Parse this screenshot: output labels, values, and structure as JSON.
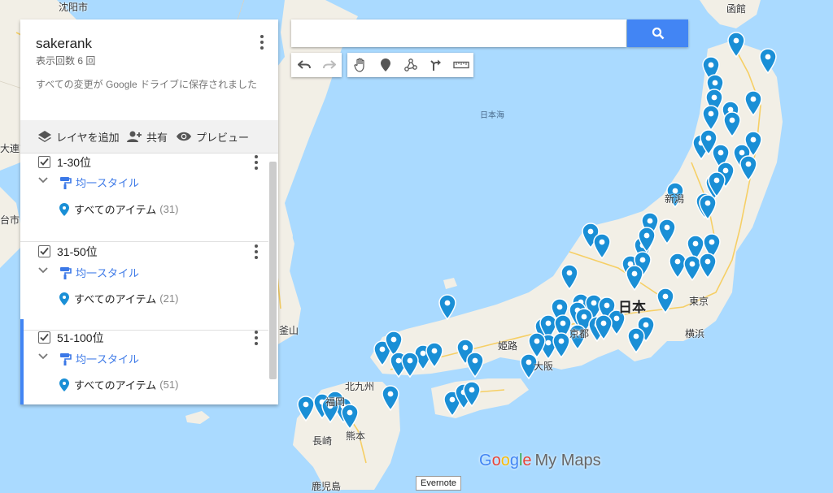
{
  "map": {
    "labels": {
      "shenyang": "沈阳市",
      "hakodate": "函館",
      "dalian": "大連市",
      "qingdao": "台市",
      "busan": "釜山",
      "sea_of_japan": "日本海",
      "japan": "日本",
      "tokyo": "東京",
      "yokohama": "横浜",
      "kyoto": "京都",
      "himeji": "姫路",
      "osaka": "大阪",
      "kitakyushu": "北九州",
      "fukuoka": "福岡",
      "nagasaki": "長崎",
      "kumamoto": "熊本",
      "niigata": "新潟",
      "kagoshima": "鹿児島"
    },
    "marker_color": "#1a8fd6",
    "land_color": "#f2efe6",
    "water_color": "#aadaff"
  },
  "panel": {
    "title": "sakerank",
    "views": "表示回数 6 回",
    "saved": "すべての変更が Google ドライブに保存されました",
    "tools": {
      "add_layer": "レイヤを追加",
      "share": "共有",
      "preview": "プレビュー"
    },
    "layers": [
      {
        "name": "1-30位",
        "style": "均一スタイル",
        "items_label": "すべてのアイテム",
        "count": "(31)"
      },
      {
        "name": "31-50位",
        "style": "均一スタイル",
        "items_label": "すべてのアイテム",
        "count": "(21)"
      },
      {
        "name": "51-100位",
        "style": "均一スタイル",
        "items_label": "すべてのアイテム",
        "count": "(51)"
      }
    ]
  },
  "search": {
    "placeholder": ""
  },
  "brand": {
    "google": "Google",
    "mymaps": "My Maps"
  },
  "tooltip": {
    "evernote": "Evernote"
  }
}
